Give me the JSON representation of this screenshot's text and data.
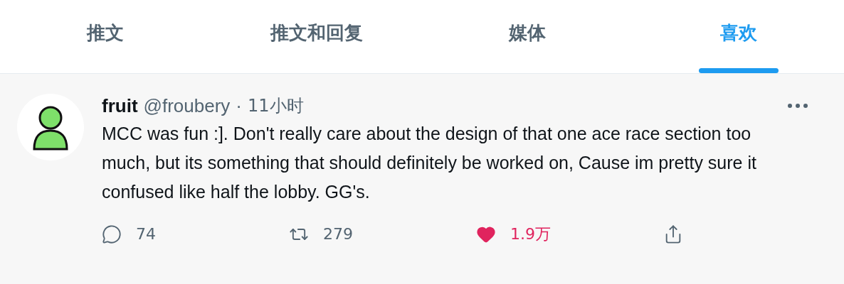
{
  "tabs": [
    {
      "label": "推文",
      "selected": false
    },
    {
      "label": "推文和回复",
      "selected": false
    },
    {
      "label": "媒体",
      "selected": false
    },
    {
      "label": "喜欢",
      "selected": true
    }
  ],
  "tweet": {
    "name": "fruit",
    "handle": "@froubery",
    "separator": "·",
    "time": "11小时",
    "text": "MCC was fun :]. Don't really care about the design of that one ace race section too much, but its something that should definitely be worked on, Cause im pretty sure it confused like half the lobby. GG's.",
    "actions": [
      {
        "kind": "reply",
        "count": "74",
        "active": false
      },
      {
        "kind": "retweet",
        "count": "279",
        "active": false
      },
      {
        "kind": "like",
        "count": "1.9万",
        "active": true
      },
      {
        "kind": "share"
      }
    ]
  }
}
